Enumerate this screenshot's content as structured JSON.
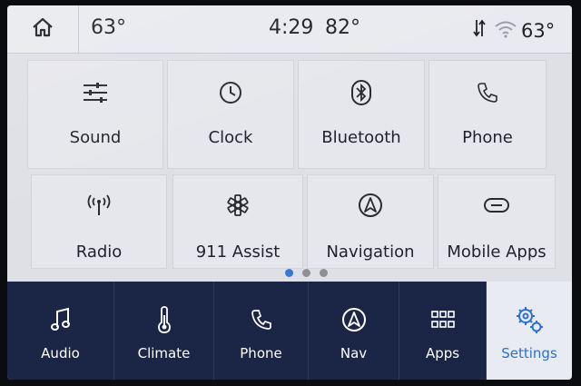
{
  "status_bar": {
    "home_icon": "home-icon",
    "outside_temp": "63°",
    "time": "4:29",
    "cabin_temp": "82°",
    "data_icon": "data-transfer-icon",
    "wifi_icon": "wifi-icon",
    "right_temp": "63°"
  },
  "tiles": [
    {
      "label": "Sound",
      "icon": "equalizer-icon"
    },
    {
      "label": "Clock",
      "icon": "clock-icon"
    },
    {
      "label": "Bluetooth",
      "icon": "bluetooth-icon"
    },
    {
      "label": "Phone",
      "icon": "phone-icon"
    },
    {
      "label": "Radio",
      "icon": "radio-antenna-icon"
    },
    {
      "label": "911 Assist",
      "icon": "star-of-life-icon"
    },
    {
      "label": "Navigation",
      "icon": "navigation-arrow-icon"
    },
    {
      "label": "Mobile Apps",
      "icon": "link-icon"
    }
  ],
  "pager": {
    "pages": 3,
    "current": 1
  },
  "dock": [
    {
      "label": "Audio",
      "icon": "music-note-icon"
    },
    {
      "label": "Climate",
      "icon": "thermometer-icon"
    },
    {
      "label": "Phone",
      "icon": "phone-icon"
    },
    {
      "label": "Nav",
      "icon": "navigation-arrow-icon"
    },
    {
      "label": "Apps",
      "icon": "apps-grid-icon"
    },
    {
      "label": "Settings",
      "icon": "gears-icon",
      "active": true
    }
  ],
  "colors": {
    "accent": "#2d6fd0",
    "dock_bg": "#1b2546",
    "tile_bg": "#e6e7ec"
  }
}
